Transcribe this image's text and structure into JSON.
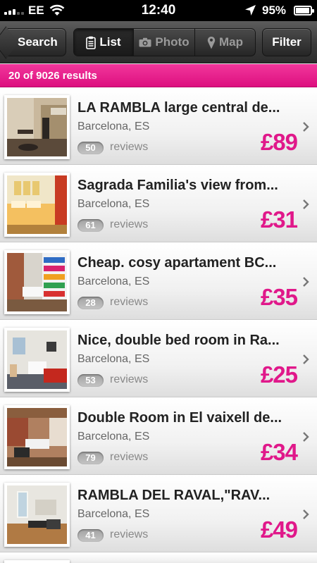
{
  "status_bar": {
    "carrier": "EE",
    "time": "12:40",
    "battery": "95%",
    "icons": [
      "signal-icon",
      "wifi-icon",
      "location-arrow-icon",
      "battery-icon"
    ]
  },
  "nav": {
    "back_label": "Search",
    "segments": [
      {
        "label": "List",
        "icon": "clipboard-icon",
        "active": true
      },
      {
        "label": "Photo",
        "icon": "camera-icon",
        "active": false
      },
      {
        "label": "Map",
        "icon": "map-pin-icon",
        "active": false
      }
    ],
    "filter_label": "Filter"
  },
  "results": {
    "summary": "20 of 9026 results"
  },
  "colors": {
    "accent": "#e0188a",
    "results_bar": "#ea2090",
    "nav_dark": "#3a3a3a"
  },
  "listings": [
    {
      "title": "LA RAMBLA large central de...",
      "location": "Barcelona, ES",
      "review_count": "50",
      "reviews_label": "reviews",
      "price": "£89"
    },
    {
      "title": "Sagrada Familia's view from...",
      "location": "Barcelona, ES",
      "review_count": "61",
      "reviews_label": "reviews",
      "price": "£31"
    },
    {
      "title": "Cheap. cosy apartament  BC...",
      "location": "Barcelona, ES",
      "review_count": "28",
      "reviews_label": "reviews",
      "price": "£35"
    },
    {
      "title": "Nice, double bed room in Ra...",
      "location": "Barcelona, ES",
      "review_count": "53",
      "reviews_label": "reviews",
      "price": "£25"
    },
    {
      "title": "Double Room in El vaixell de...",
      "location": "Barcelona, ES",
      "review_count": "79",
      "reviews_label": "reviews",
      "price": "£34"
    },
    {
      "title": " RAMBLA DEL RAVAL,\"RAV...",
      "location": "Barcelona, ES",
      "review_count": "41",
      "reviews_label": "reviews",
      "price": "£49"
    }
  ]
}
